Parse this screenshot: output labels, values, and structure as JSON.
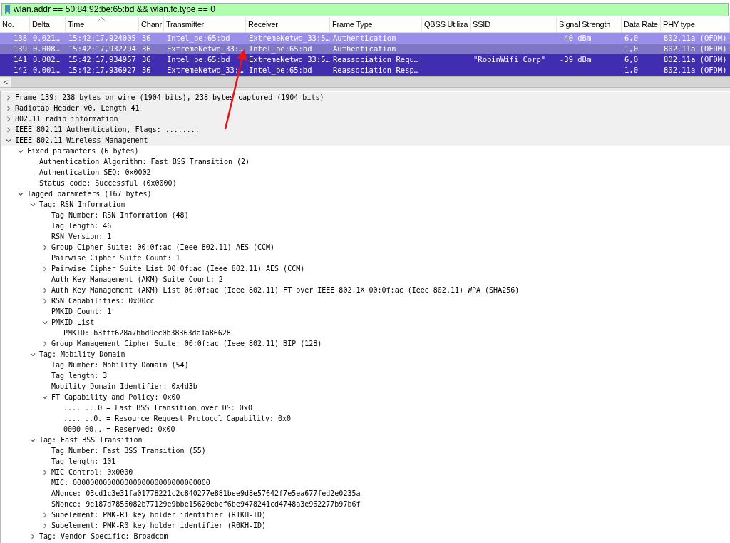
{
  "filter": {
    "value": "wlan.addr == 50:84:92:be:65:bd && wlan.fc.type == 0"
  },
  "packet_list": {
    "columns": [
      "No.",
      "Delta",
      "Time",
      "Chanr",
      "Transmitter",
      "Receiver",
      "Frame Type",
      "QBSS Utiliza",
      "SSID",
      "Signal Strength",
      "Data Rate",
      "PHY type"
    ],
    "rows": [
      {
        "color": "#9a8fe8",
        "cells": [
          "138",
          "0.021…",
          "15:42:17,924005",
          "36",
          "Intel_be:65:bd",
          "ExtremeNetwo_33:5…",
          "Authentication",
          "",
          "",
          "-40 dBm",
          "6,0",
          "802.11a (OFDM)"
        ]
      },
      {
        "color": "#7f76c6",
        "cells": [
          "139",
          "0.008…",
          "15:42:17,932294",
          "36",
          "ExtremeNetwo_33:…",
          "Intel_be:65:bd",
          "Authentication",
          "",
          "",
          "",
          "1,0",
          "802.11a (OFDM)"
        ]
      },
      {
        "color": "#412db0",
        "cells": [
          "141",
          "0.002…",
          "15:42:17,934957",
          "36",
          "Intel_be:65:bd",
          "ExtremeNetwo_33:5…",
          "Reassociation Requ…",
          "",
          "\"RobinWifi_Corp\"",
          "-39 dBm",
          "6,0",
          "802.11a (OFDM)"
        ]
      },
      {
        "color": "#412db0",
        "cells": [
          "142",
          "0.001…",
          "15:42:17,936927",
          "36",
          "ExtremeNetwo_33:…",
          "Intel_be:65:bd",
          "Reassociation Resp…",
          "",
          "",
          "",
          "1,0",
          "802.11a (OFDM)"
        ]
      }
    ],
    "scroll_left": "<"
  },
  "details": [
    {
      "label": "Frame 139: 238 bytes on wire (1904 bits), 238 bytes captured (1904 bits)",
      "expanded": false
    },
    {
      "label": "Radiotap Header v0, Length 41",
      "expanded": false
    },
    {
      "label": "802.11 radio information",
      "expanded": false
    },
    {
      "label": "IEEE 802.11 Authentication, Flags: ........",
      "expanded": false
    },
    {
      "label": "IEEE 802.11 Wireless Management",
      "expanded": true,
      "children": [
        {
          "label": "Fixed parameters (6 bytes)",
          "expanded": true,
          "children": [
            {
              "label": "Authentication Algorithm: Fast BSS Transition (2)"
            },
            {
              "label": "Authentication SEQ: 0x0002"
            },
            {
              "label": "Status code: Successful (0x0000)"
            }
          ]
        },
        {
          "label": "Tagged parameters (167 bytes)",
          "expanded": true,
          "children": [
            {
              "label": "Tag: RSN Information",
              "expanded": true,
              "children": [
                {
                  "label": "Tag Number: RSN Information (48)"
                },
                {
                  "label": "Tag length: 46"
                },
                {
                  "label": "RSN Version: 1"
                },
                {
                  "label": "Group Cipher Suite: 00:0f:ac (Ieee 802.11) AES (CCM)",
                  "expanded": false
                },
                {
                  "label": "Pairwise Cipher Suite Count: 1"
                },
                {
                  "label": "Pairwise Cipher Suite List 00:0f:ac (Ieee 802.11) AES (CCM)",
                  "expanded": false
                },
                {
                  "label": "Auth Key Management (AKM) Suite Count: 2"
                },
                {
                  "label": "Auth Key Management (AKM) List 00:0f:ac (Ieee 802.11) FT over IEEE 802.1X 00:0f:ac (Ieee 802.11) WPA (SHA256)",
                  "expanded": false
                },
                {
                  "label": "RSN Capabilities: 0x00cc",
                  "expanded": false
                },
                {
                  "label": "PMKID Count: 1"
                },
                {
                  "label": "PMKID List",
                  "expanded": true,
                  "children": [
                    {
                      "label": "PMKID: b3fff628a7bbd9ec0b38363da1a86628"
                    }
                  ]
                },
                {
                  "label": "Group Management Cipher Suite: 00:0f:ac (Ieee 802.11) BIP (128)",
                  "expanded": false
                }
              ]
            },
            {
              "label": "Tag: Mobility Domain",
              "expanded": true,
              "children": [
                {
                  "label": "Tag Number: Mobility Domain (54)"
                },
                {
                  "label": "Tag length: 3"
                },
                {
                  "label": "Mobility Domain Identifier: 0x4d3b"
                },
                {
                  "label": "FT Capability and Policy: 0x00",
                  "expanded": true,
                  "children": [
                    {
                      "label": ".... ...0 = Fast BSS Transition over DS: 0x0"
                    },
                    {
                      "label": ".... ..0. = Resource Request Protocol Capability: 0x0"
                    },
                    {
                      "label": "0000 00.. = Reserved: 0x00"
                    }
                  ]
                }
              ]
            },
            {
              "label": "Tag: Fast BSS Transition",
              "expanded": true,
              "children": [
                {
                  "label": "Tag Number: Fast BSS Transition (55)"
                },
                {
                  "label": "Tag length: 101"
                },
                {
                  "label": "MIC Control: 0x0000",
                  "expanded": false
                },
                {
                  "label": "MIC: 00000000000000000000000000000000"
                },
                {
                  "label": "ANonce: 03cd1c3e31fa01778221c2c840277e881bee9d8e57642f7e5ea677fed2e0235a"
                },
                {
                  "label": "SNonce: 9e187d7856082b77129e9bbe15620ebef6be9478241cd4748a3e962277b97b6f"
                },
                {
                  "label": "Subelement: PMK-R1 key holder identifier (R1KH-ID)",
                  "expanded": false
                },
                {
                  "label": "Subelement: PMK-R0 key holder identifier (R0KH-ID)",
                  "expanded": false
                }
              ]
            },
            {
              "label": "Tag: Vendor Specific: Broadcom",
              "expanded": false
            }
          ]
        }
      ]
    }
  ]
}
